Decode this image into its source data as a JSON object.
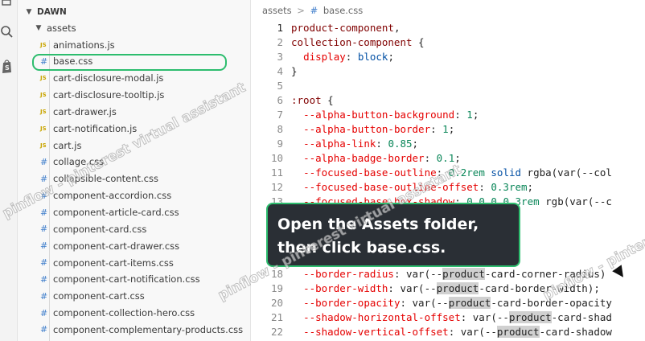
{
  "explorer": {
    "root_label": "DAWN",
    "folder_label": "assets",
    "files": [
      {
        "name": "animations.js",
        "type": "js"
      },
      {
        "name": "base.css",
        "type": "css"
      },
      {
        "name": "cart-disclosure-modal.js",
        "type": "js"
      },
      {
        "name": "cart-disclosure-tooltip.js",
        "type": "js"
      },
      {
        "name": "cart-drawer.js",
        "type": "js"
      },
      {
        "name": "cart-notification.js",
        "type": "js"
      },
      {
        "name": "cart.js",
        "type": "js"
      },
      {
        "name": "collage.css",
        "type": "css"
      },
      {
        "name": "collapsible-content.css",
        "type": "css"
      },
      {
        "name": "component-accordion.css",
        "type": "css"
      },
      {
        "name": "component-article-card.css",
        "type": "css"
      },
      {
        "name": "component-card.css",
        "type": "css"
      },
      {
        "name": "component-cart-drawer.css",
        "type": "css"
      },
      {
        "name": "component-cart-items.css",
        "type": "css"
      },
      {
        "name": "component-cart-notification.css",
        "type": "css"
      },
      {
        "name": "component-cart.css",
        "type": "css"
      },
      {
        "name": "component-collection-hero.css",
        "type": "css"
      },
      {
        "name": "component-complementary-products.css",
        "type": "css"
      }
    ],
    "file_icon_js": "JS",
    "file_icon_css": "#"
  },
  "breadcrumb": {
    "folder": "assets",
    "separator": ">",
    "file_icon": "#",
    "file": "base.css"
  },
  "code_lines": [
    {
      "n": "1",
      "text": "product-component,"
    },
    {
      "n": "2",
      "text": "collection-component {"
    },
    {
      "n": "3",
      "text": "  display: block;"
    },
    {
      "n": "4",
      "text": "}"
    },
    {
      "n": "5",
      "text": ""
    },
    {
      "n": "6",
      "text": ":root {"
    },
    {
      "n": "7",
      "text": "  --alpha-button-background: 1;"
    },
    {
      "n": "8",
      "text": "  --alpha-button-border: 1;"
    },
    {
      "n": "9",
      "text": "  --alpha-link: 0.85;"
    },
    {
      "n": "10",
      "text": "  --alpha-badge-border: 0.1;"
    },
    {
      "n": "11",
      "text": "  --focused-base-outline: 0.2rem solid rgba(var(--col"
    },
    {
      "n": "12",
      "text": "  --focused-base-outline-offset: 0.3rem;"
    },
    {
      "n": "13",
      "text": "  --focused-base-box-shadow: 0 0 0 0.3rem rgb(var(--c"
    },
    {
      "n": "18",
      "text": "  --border-radius: var(--product-card-corner-radius)"
    },
    {
      "n": "19",
      "text": "  --border-width: var(--product-card-border-width);"
    },
    {
      "n": "20",
      "text": "  --border-opacity: var(--product-card-border-opacity"
    },
    {
      "n": "21",
      "text": "  --shadow-horizontal-offset: var(--product-card-shad"
    },
    {
      "n": "22",
      "text": "  --shadow-vertical-offset: var(--product-card-shadow"
    }
  ],
  "tooltip": {
    "line1": "Open the Assets folder,",
    "line2": "then click base.css."
  },
  "watermarks": [
    "pinflow - pinterest virtual assistant"
  ],
  "colors": {
    "highlight_ring": "#2dbd6e",
    "tooltip_bg": "#2a2f35"
  }
}
